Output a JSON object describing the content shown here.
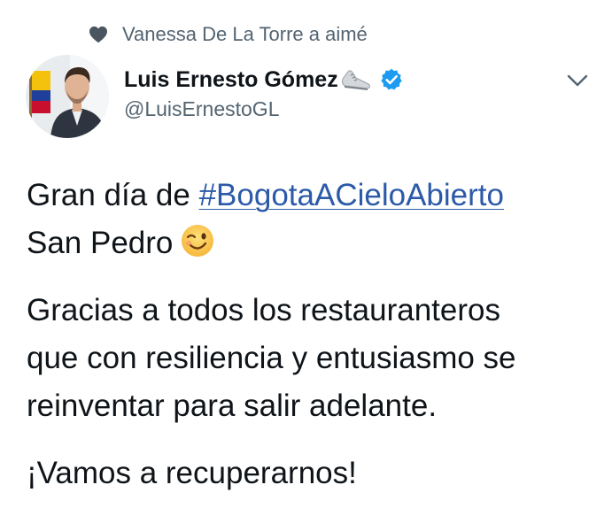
{
  "context": {
    "icon": "heart-icon",
    "text": "Vanessa De La Torre a aimé"
  },
  "author": {
    "display_name": "Luis Ernesto Gómez",
    "name_emoji": "running-shoe-icon",
    "verified_icon": "verified-badge-icon",
    "handle": "@LuisErnestoGL",
    "avatar": "avatar-photo"
  },
  "menu": {
    "icon": "chevron-down-icon"
  },
  "tweet": {
    "line1_prefix": "Gran día de ",
    "hashtag": "#BogotaACieloAbierto",
    "line2_text": "San Pedro",
    "line2_emoji": "winking-face-icon",
    "para2_lines": [
      "Gracias a todos los restauranteros",
      "que con resiliencia y entusiasmo se",
      "reinventar para salir adelante."
    ],
    "para3": "¡Vamos a recuperarnos!"
  },
  "colors": {
    "text": "#0f1419",
    "secondary": "#536471",
    "link": "#2b5aa8",
    "verified": "#1d9bf0",
    "heart": "#4a5560"
  }
}
